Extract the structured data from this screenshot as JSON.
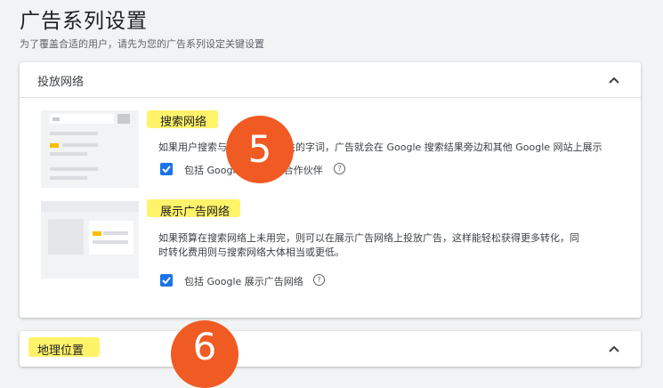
{
  "page": {
    "title": "广告系列设置",
    "subtitle": "为了覆盖合适的用户，请先为您的广告系列设定关键设置"
  },
  "network_card": {
    "title": "投放网络",
    "search": {
      "title": "搜索网络",
      "description": "如果用户搜索与您的关键字相关的字词，广告就会在 Google 搜索结果旁边和其他 Google 网站上展示",
      "checkbox_label": "包括 Google 搜索网络合作伙伴",
      "checked": true
    },
    "display": {
      "title": "展示广告网络",
      "description_line1": "如果预算在搜索网络上未用完，则可以在展示广告网络上投放广告，这样能轻松获得更多转化，同",
      "description_line2": "时转化费用则与搜索网络大体相当或更低。",
      "checkbox_label": "包括 Google 展示广告网络",
      "checked": true
    }
  },
  "location_card": {
    "title": "地理位置"
  },
  "badges": {
    "step5": "5",
    "step6": "6"
  },
  "colors": {
    "accent": "#1a73e8",
    "highlight": "#fff36a",
    "badge": "#f05a23"
  },
  "icons": {
    "collapse": "chevron-up-icon",
    "help": "help-circle-icon",
    "check": "checkmark-icon"
  }
}
